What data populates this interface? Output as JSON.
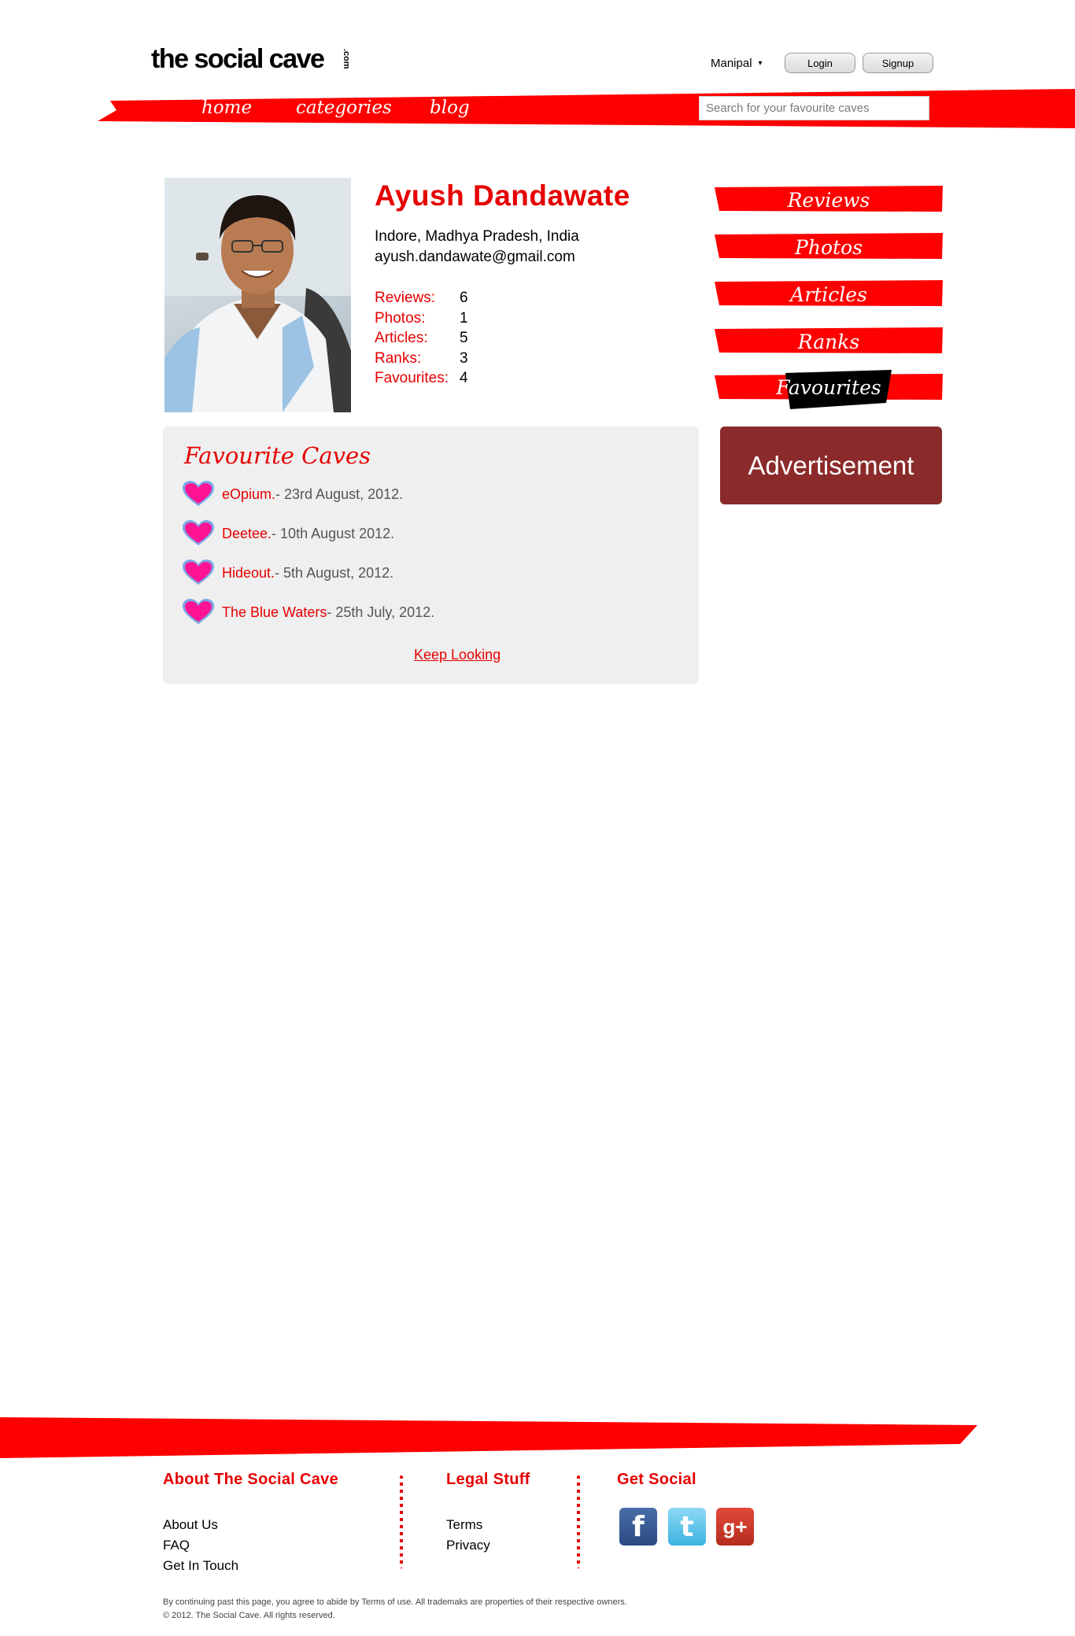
{
  "header": {
    "logo_text": "the social cave",
    "logo_suffix": ".com",
    "city": "Manipal",
    "login_label": "Login",
    "signup_label": "Signup",
    "search_placeholder": "Search for your favourite caves"
  },
  "nav": {
    "home": "home",
    "categories": "categories",
    "blog": "blog"
  },
  "profile": {
    "name": "Ayush Dandawate",
    "location": "Indore, Madhya Pradesh, India",
    "email": "ayush.dandawate@gmail.com",
    "stats": [
      {
        "label": "Reviews:",
        "value": "6"
      },
      {
        "label": "Photos:",
        "value": "1"
      },
      {
        "label": "Articles:",
        "value": "5"
      },
      {
        "label": "Ranks:",
        "value": "3"
      },
      {
        "label": "Favourites:",
        "value": "4"
      }
    ]
  },
  "tabs": [
    "Reviews",
    "Photos",
    "Articles",
    "Ranks",
    "Favourites"
  ],
  "active_tab": "Favourites",
  "favourites": {
    "title": "Favourite Caves",
    "items": [
      {
        "name": "eOpium.",
        "date": " - 23rd August, 2012."
      },
      {
        "name": "Deetee.",
        "date": " - 10th August 2012."
      },
      {
        "name": "Hideout.",
        "date": " - 5th August, 2012."
      },
      {
        "name": "The Blue Waters",
        "date": " - 25th July, 2012."
      }
    ],
    "more_link": "Keep Looking"
  },
  "advertisement": "Advertisement",
  "footer": {
    "about_heading": "About The Social Cave",
    "about_links": [
      "About Us",
      "FAQ",
      "Get In Touch"
    ],
    "legal_heading": "Legal Stuff",
    "legal_links": [
      "Terms",
      "Privacy"
    ],
    "social_heading": "Get Social",
    "social_icons": [
      "facebook-icon",
      "twitter-icon",
      "google-plus-icon"
    ],
    "disclaimer": "By continuing past this page, you agree to abide by Terms of use. All trademaks are properties of their respective owners.",
    "copyright": "© 2012. The Social Cave. All rights reserved."
  },
  "colors": {
    "brand_red": "#e60000",
    "panel_bg": "#efefef",
    "ad_bg": "#8b2a2a"
  }
}
